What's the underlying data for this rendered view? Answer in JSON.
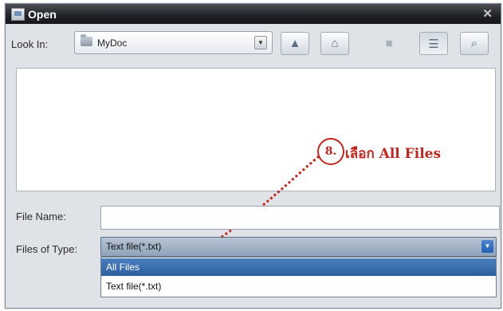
{
  "window": {
    "title": "Open"
  },
  "lookin": {
    "label": "Look In:",
    "value": "MyDoc"
  },
  "toolbar": {
    "buttons": [
      {
        "name": "up-folder",
        "glyph": "▲"
      },
      {
        "name": "home",
        "glyph": "⌂"
      },
      {
        "name": "new-folder",
        "glyph": "■"
      },
      {
        "name": "list-view",
        "glyph": "☰"
      },
      {
        "name": "details-view",
        "glyph": "⌕"
      }
    ]
  },
  "annotation": {
    "step": "8.",
    "text": "เลือก All Files",
    "color": "#c4261f"
  },
  "filename": {
    "label": "File Name:",
    "value": ""
  },
  "filetype": {
    "label": "Files of Type:",
    "value": "Text file(*.txt)",
    "options": [
      "All Files",
      "Text file(*.txt)"
    ],
    "highlighted_index": 0
  }
}
